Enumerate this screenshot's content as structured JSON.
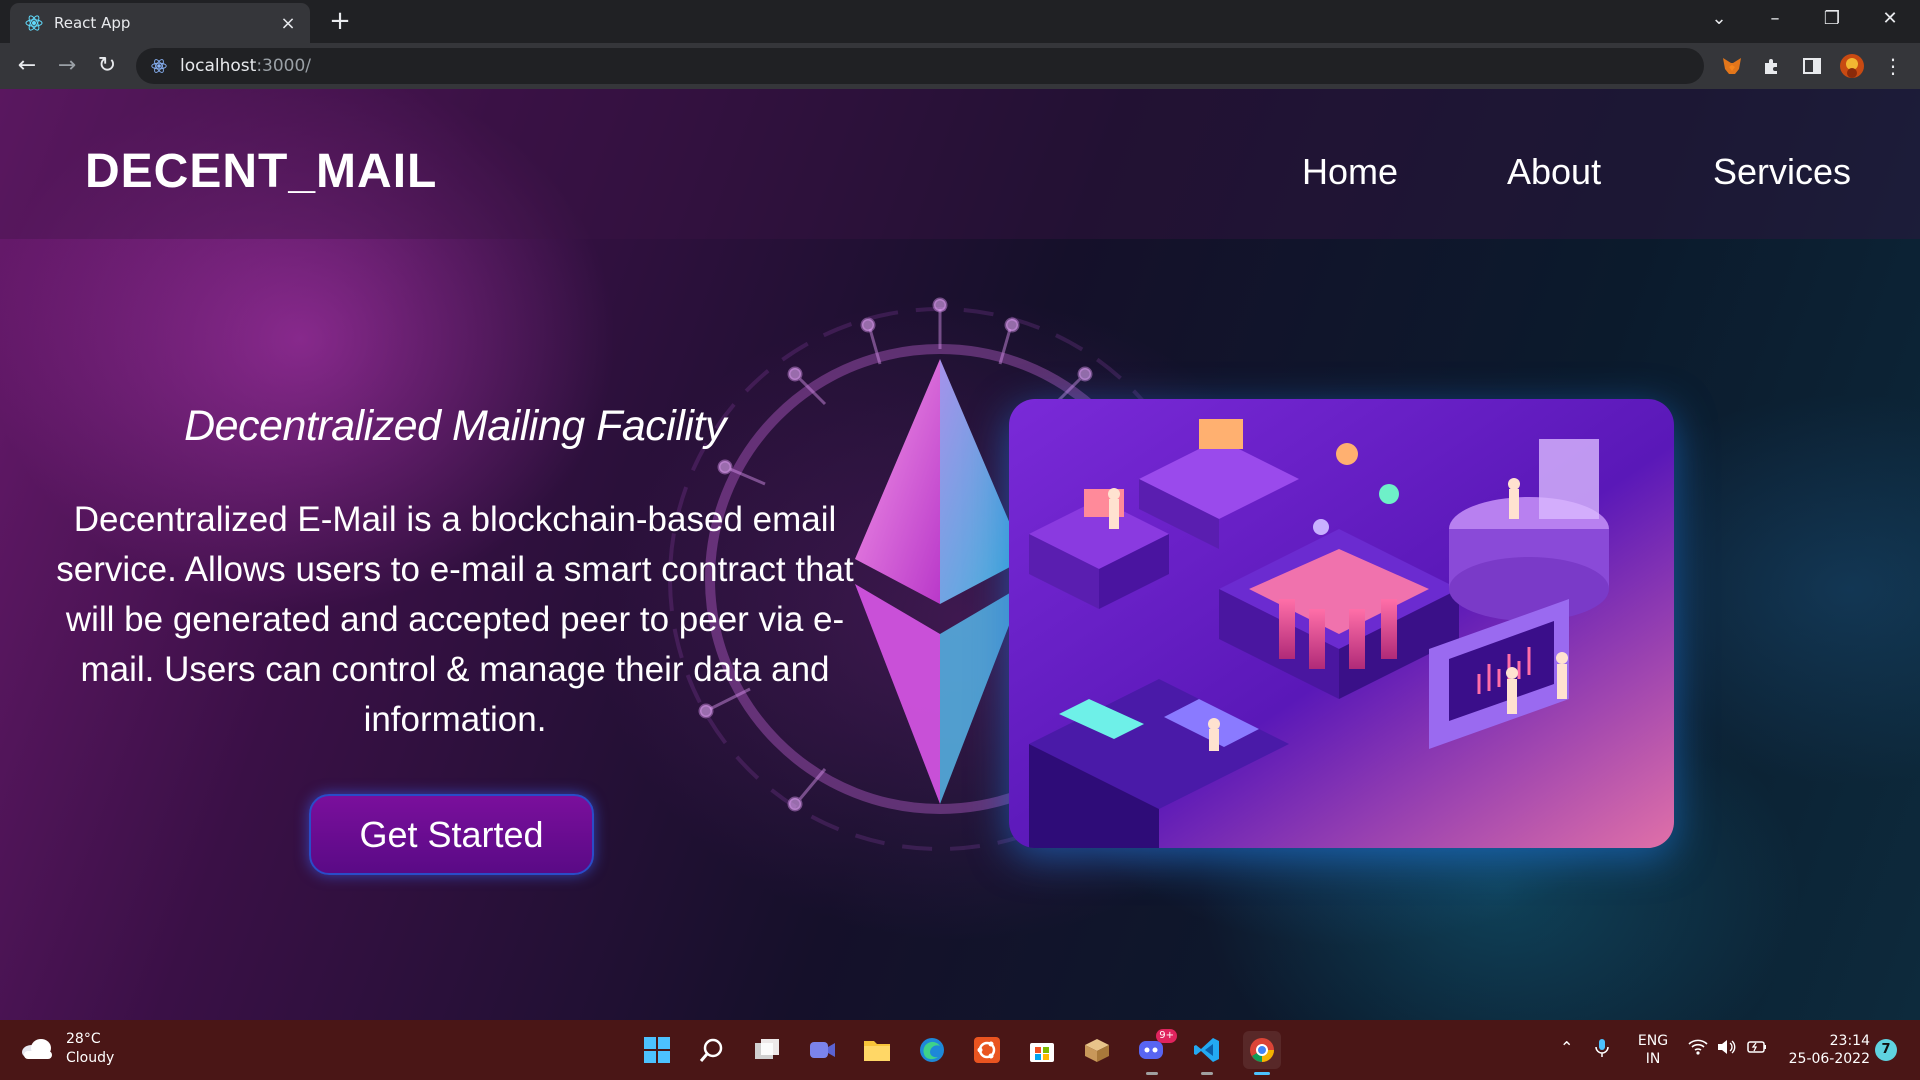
{
  "browser": {
    "tab_title": "React App",
    "tab_close_symbol": "×",
    "new_tab_symbol": "+",
    "url_host": "localhost",
    "url_path": ":3000/"
  },
  "site": {
    "brand": "DECENT_MAIL",
    "nav": [
      "Home",
      "About",
      "Services"
    ],
    "hero_title": "Decentralized Mailing Facility",
    "hero_text": "Decentralized E-Mail is a blockchain-based email service. Allows users to e-mail a smart contract that will be generated and accepted peer to peer via e-mail. Users can control & manage their data and information.",
    "cta_label": "Get Started"
  },
  "taskbar": {
    "weather_temp": "28°C",
    "weather_condition": "Cloudy",
    "apps": [
      "start-icon",
      "search-icon",
      "task-view-icon",
      "teams-icon",
      "file-explorer-icon",
      "edge-icon",
      "ubuntu-icon",
      "store-icon",
      "box-icon",
      "discord-icon",
      "vscode-icon",
      "chrome-icon"
    ],
    "discord_badge": "9+",
    "lang_top": "ENG",
    "lang_bottom": "IN",
    "time": "23:14",
    "date": "25-06-2022",
    "notification_count": "7"
  },
  "colors": {
    "chrome_bg": "#202124",
    "toolbar_bg": "#35363a",
    "cta_bg": "#6a0c92",
    "cta_border": "#2a4cc8",
    "taskbar_bg": "#4a1616"
  }
}
